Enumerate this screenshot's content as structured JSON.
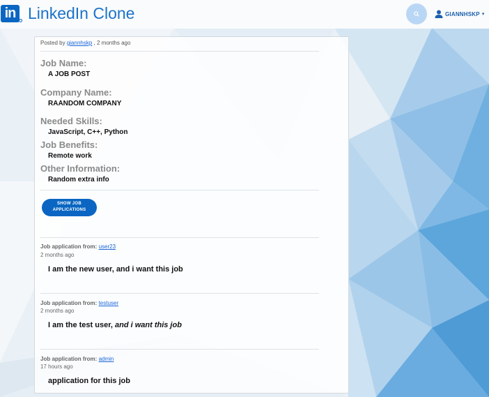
{
  "navbar": {
    "logo_text": "in",
    "brand": "LinkedIn Clone",
    "search_icon": "search-icon",
    "user_icon": "user-icon",
    "username": "GIANNHSKP"
  },
  "post": {
    "posted_by_prefix": "Posted by",
    "author": "giannhskp",
    "time_suffix": ", 2 months ago",
    "fields": {
      "job_name_label": "Job Name:",
      "job_name": "A JOB POST",
      "company_label": "Company Name:",
      "company": "RAANDOM COMPANY",
      "skills_label": "Needed Skills:",
      "skills": "JavaScript, C++, Python",
      "benefits_label": "Job Benefits:",
      "benefits": "Remote work",
      "other_label": "Other Information:",
      "other": "Random extra info"
    },
    "show_button_line1": "SHOW JOB",
    "show_button_line2": "APPLICATIONS"
  },
  "applications": [
    {
      "from_label": "Job application from:",
      "user": "user23",
      "time": "2 months ago",
      "text_plain": "I am the new user, and i want this job",
      "text_italic": ""
    },
    {
      "from_label": "Job application from:",
      "user": "testuser",
      "time": "2 months ago",
      "text_plain": "I am the test user, ",
      "text_italic": "and i want this job"
    },
    {
      "from_label": "Job application from:",
      "user": "admin",
      "time": "17 hours ago",
      "text_plain": "application for this job",
      "text_italic": ""
    }
  ],
  "colors": {
    "brand_blue": "#0a66c2",
    "link_blue": "#1a66d8",
    "label_gray": "#8a8a8a"
  }
}
